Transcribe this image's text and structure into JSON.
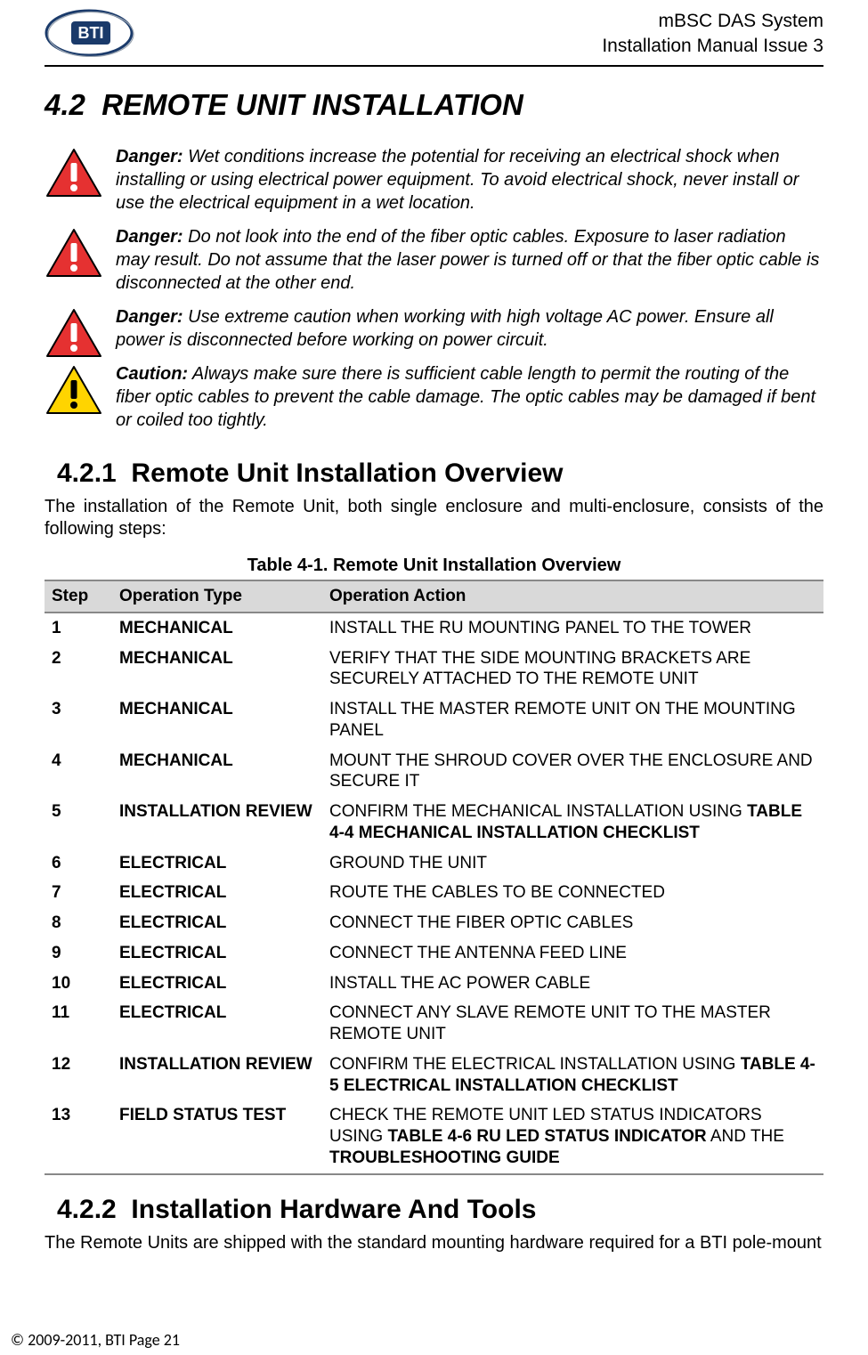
{
  "header": {
    "product": "mBSC DAS System",
    "doc": "Installation Manual Issue 3",
    "logo_alt": "BTI logo"
  },
  "section": {
    "number": "4.2",
    "title": "REMOTE UNIT INSTALLATION"
  },
  "warnings": [
    {
      "kind": "danger",
      "label": "Danger:",
      "text": "Wet conditions increase the potential for receiving an electrical shock when installing or using electrical power equipment. To avoid electrical shock, never install or use the electrical equipment in a wet location."
    },
    {
      "kind": "danger",
      "label": "Danger:",
      "text": "Do not look into the end of the fiber optic cables. Exposure to laser radiation may result. Do not assume that the laser power is turned off or that the fiber optic cable is disconnected at the other end."
    },
    {
      "kind": "danger",
      "label": "Danger:",
      "text": "Use extreme caution when working with high voltage AC power. Ensure all power is disconnected before working on power circuit."
    },
    {
      "kind": "caution",
      "label": "Caution:",
      "text": "Always make sure there is sufficient cable length to permit the routing of the fiber optic cables to prevent the cable damage. The optic cables may be damaged if bent or coiled too tightly."
    }
  ],
  "subsection1": {
    "number": "4.2.1",
    "title": "Remote Unit Installation Overview",
    "intro": "The installation of the Remote Unit, both single enclosure and multi-enclosure, consists of the following steps:"
  },
  "table": {
    "caption": "Table 4-1. Remote Unit Installation Overview",
    "headers": {
      "step": "Step",
      "type": "Operation Type",
      "action": "Operation Action"
    },
    "rows": [
      {
        "step": "1",
        "type": "MECHANICAL",
        "action_pre": "INSTALL THE RU MOUNTING PANEL TO THE TOWER",
        "action_strong": "",
        "action_post": ""
      },
      {
        "step": "2",
        "type": "MECHANICAL",
        "action_pre": "VERIFY THAT THE SIDE MOUNTING BRACKETS ARE SECURELY ATTACHED TO THE REMOTE UNIT",
        "action_strong": "",
        "action_post": ""
      },
      {
        "step": "3",
        "type": "MECHANICAL",
        "action_pre": "INSTALL THE MASTER REMOTE UNIT ON THE MOUNTING PANEL",
        "action_strong": "",
        "action_post": ""
      },
      {
        "step": "4",
        "type": "MECHANICAL",
        "action_pre": "MOUNT THE SHROUD COVER OVER THE ENCLOSURE AND SECURE IT",
        "action_strong": "",
        "action_post": ""
      },
      {
        "step": "5",
        "type": "INSTALLATION REVIEW",
        "action_pre": "CONFIRM THE MECHANICAL INSTALLATION USING ",
        "action_strong": "TABLE 4-4 MECHANICAL INSTALLATION CHECKLIST",
        "action_post": ""
      },
      {
        "step": "6",
        "type": "ELECTRICAL",
        "action_pre": "GROUND THE UNIT",
        "action_strong": "",
        "action_post": ""
      },
      {
        "step": "7",
        "type": "ELECTRICAL",
        "action_pre": "ROUTE THE CABLES TO BE CONNECTED",
        "action_strong": "",
        "action_post": ""
      },
      {
        "step": "8",
        "type": "ELECTRICAL",
        "action_pre": "CONNECT THE FIBER OPTIC CABLES",
        "action_strong": "",
        "action_post": ""
      },
      {
        "step": "9",
        "type": "ELECTRICAL",
        "action_pre": "CONNECT THE ANTENNA FEED LINE",
        "action_strong": "",
        "action_post": ""
      },
      {
        "step": "10",
        "type": "ELECTRICAL",
        "action_pre": "INSTALL THE AC POWER CABLE",
        "action_strong": "",
        "action_post": ""
      },
      {
        "step": "11",
        "type": "ELECTRICAL",
        "action_pre": "CONNECT ANY SLAVE REMOTE UNIT TO THE MASTER REMOTE UNIT",
        "action_strong": "",
        "action_post": ""
      },
      {
        "step": "12",
        "type": "INSTALLATION REVIEW",
        "action_pre": "CONFIRM THE ELECTRICAL INSTALLATION USING ",
        "action_strong": "TABLE 4-5 ELECTRICAL INSTALLATION CHECKLIST",
        "action_post": ""
      },
      {
        "step": "13",
        "type": "FIELD STATUS TEST",
        "action_pre": "CHECK THE REMOTE UNIT LED STATUS INDICATORS USING ",
        "action_strong": "TABLE 4-6  RU LED STATUS INDICATOR",
        "action_post": " AND THE ",
        "action_strong2": "TROUBLESHOOTING GUIDE"
      }
    ]
  },
  "subsection2": {
    "number": "4.2.2",
    "title": "Installation Hardware And Tools",
    "intro": "The Remote Units are shipped with the standard mounting hardware required for a BTI pole-mount"
  },
  "footer": "© 2009-2011, BTI Page 21"
}
